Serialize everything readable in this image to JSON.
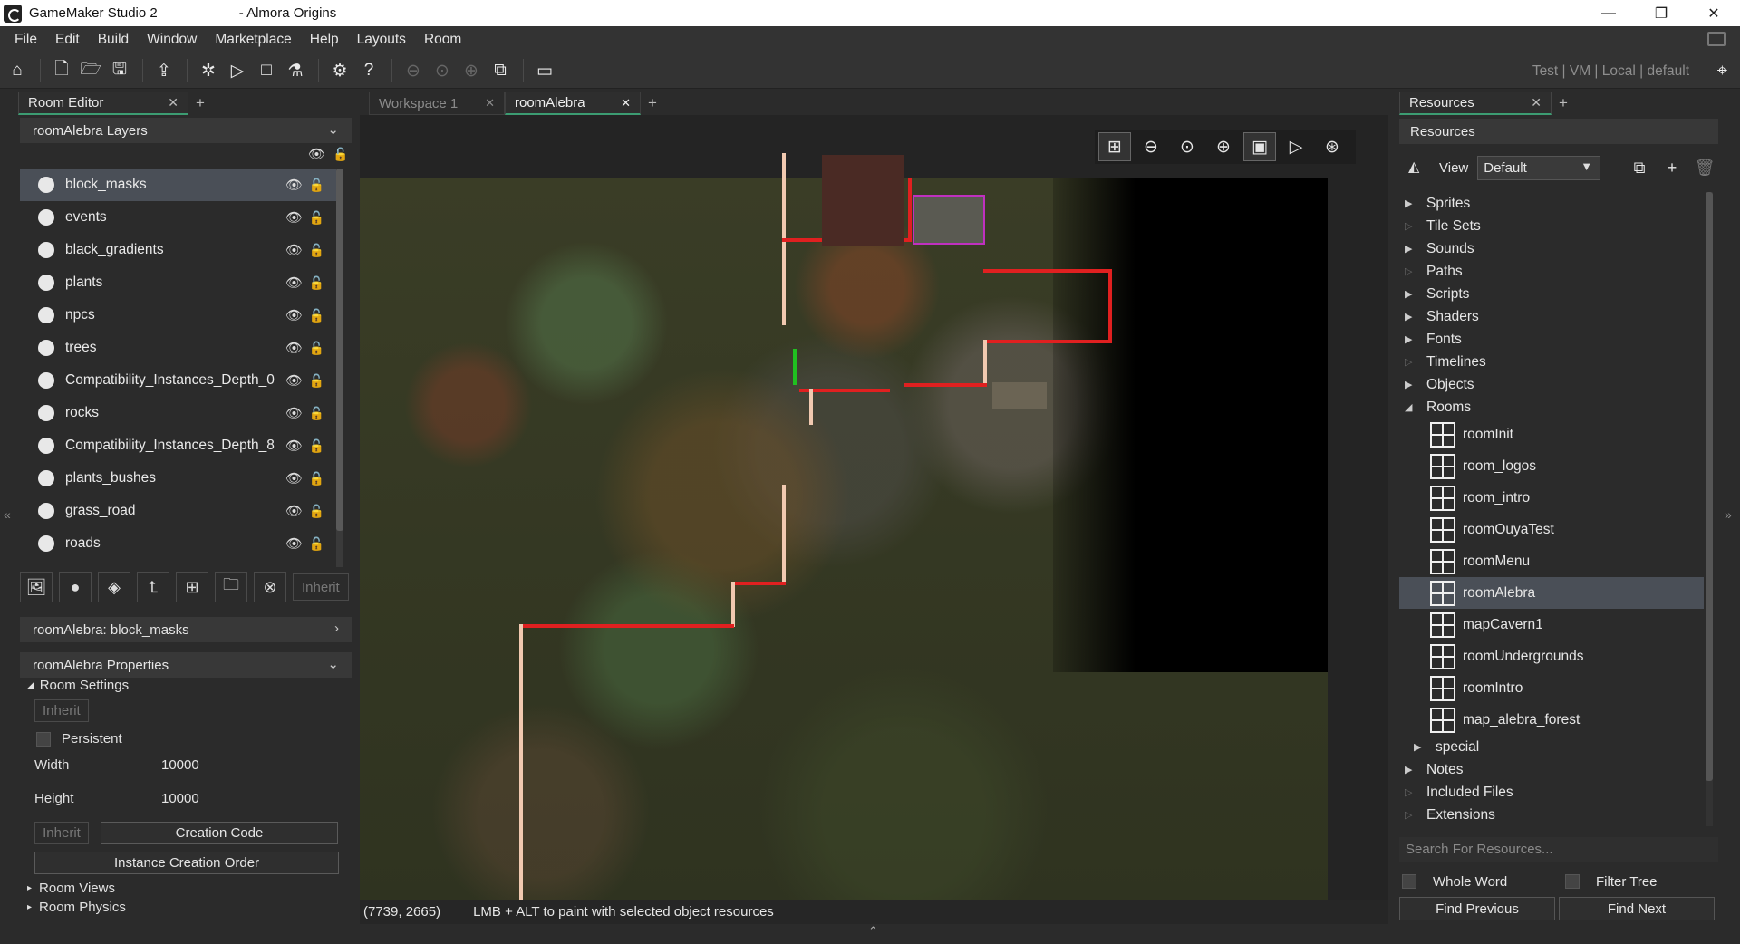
{
  "window": {
    "app_name": "GameMaker Studio 2",
    "project": "- Almora Origins",
    "controls": [
      "—",
      "❐",
      "✕"
    ]
  },
  "menu": [
    "File",
    "Edit",
    "Build",
    "Window",
    "Marketplace",
    "Help",
    "Layouts",
    "Room"
  ],
  "toolbar": {
    "target_info": "Test | VM | Local | default"
  },
  "left_panel": {
    "tab_label": "Room Editor",
    "layers_header": "roomAlebra Layers",
    "layers": [
      {
        "label": "block_masks",
        "selected": true
      },
      {
        "label": "events"
      },
      {
        "label": "black_gradients"
      },
      {
        "label": "plants"
      },
      {
        "label": "npcs"
      },
      {
        "label": "trees"
      },
      {
        "label": "Compatibility_Instances_Depth_0"
      },
      {
        "label": "rocks"
      },
      {
        "label": "Compatibility_Instances_Depth_8"
      },
      {
        "label": "plants_bushes"
      },
      {
        "label": "grass_road"
      },
      {
        "label": "roads"
      }
    ],
    "inherit_label": "Inherit",
    "layer_props_header": "roomAlebra: block_masks",
    "room_props_header": "roomAlebra Properties",
    "room_settings": "Room Settings",
    "inherit_small": "Inherit",
    "persistent_label": "Persistent",
    "width_label": "Width",
    "width_value": "10000",
    "height_label": "Height",
    "height_value": "10000",
    "inherit_small2": "Inherit",
    "creation_code": "Creation Code",
    "instance_creation_order": "Instance Creation Order",
    "room_views": "Room Views",
    "room_physics": "Room Physics"
  },
  "doc_tabs": [
    {
      "label": "Workspace 1",
      "active": false
    },
    {
      "label": "roomAlebra",
      "active": true
    }
  ],
  "status": {
    "coords": "(7739, 2665)",
    "hint": "LMB + ALT to paint with selected object resources"
  },
  "right_panel": {
    "tab_label": "Resources",
    "header": "Resources",
    "view_label": "View",
    "view_value": "Default",
    "groups_top": [
      {
        "label": "Sprites",
        "expandable": true
      },
      {
        "label": "Tile Sets",
        "expandable": false
      },
      {
        "label": "Sounds",
        "expandable": true
      },
      {
        "label": "Paths",
        "expandable": false
      },
      {
        "label": "Scripts",
        "expandable": true
      },
      {
        "label": "Shaders",
        "expandable": true
      },
      {
        "label": "Fonts",
        "expandable": true
      },
      {
        "label": "Timelines",
        "expandable": false
      },
      {
        "label": "Objects",
        "expandable": true
      },
      {
        "label": "Rooms",
        "expanded": true
      }
    ],
    "rooms": [
      {
        "label": "roomInit"
      },
      {
        "label": "room_logos"
      },
      {
        "label": "room_intro"
      },
      {
        "label": "roomOuyaTest"
      },
      {
        "label": "roomMenu"
      },
      {
        "label": "roomAlebra",
        "selected": true
      },
      {
        "label": "mapCavern1"
      },
      {
        "label": "roomUndergrounds"
      },
      {
        "label": "roomIntro"
      },
      {
        "label": "map_alebra_forest"
      }
    ],
    "special": "special",
    "groups_bottom": [
      {
        "label": "Notes",
        "expandable": true
      },
      {
        "label": "Included Files",
        "expandable": false
      },
      {
        "label": "Extensions",
        "expandable": false
      }
    ],
    "search_placeholder": "Search For Resources...",
    "whole_word": "Whole Word",
    "filter_tree": "Filter Tree",
    "find_previous": "Find Previous",
    "find_next": "Find Next"
  }
}
